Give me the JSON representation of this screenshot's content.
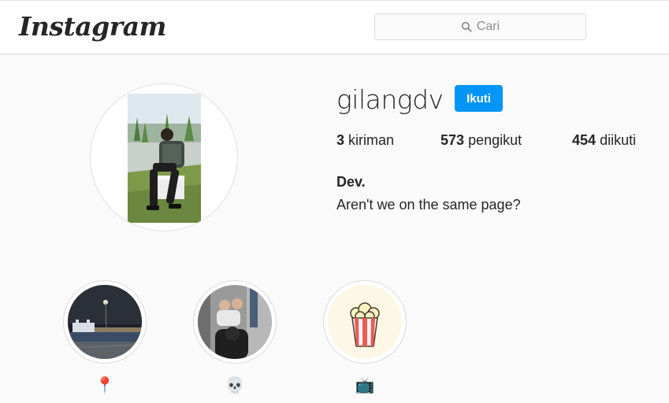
{
  "header": {
    "logo_text": "Instagram",
    "search": {
      "placeholder": "Cari",
      "icon": "search-icon"
    }
  },
  "profile": {
    "username": "gilangdv",
    "follow_label": "Ikuti",
    "accent_color": "#0095f6",
    "stats": [
      {
        "count": "3",
        "label": "kiriman"
      },
      {
        "count": "573",
        "label": "pengikut"
      },
      {
        "count": "454",
        "label": "diikuti"
      }
    ],
    "full_name": "Dev.",
    "bio": "Aren't we on the same page?"
  },
  "highlights": [
    {
      "label": "📍",
      "cover": "night-city-photo"
    },
    {
      "label": "💀",
      "cover": "group-selfie-photo"
    },
    {
      "label": "📺",
      "cover": "popcorn-icon"
    }
  ]
}
